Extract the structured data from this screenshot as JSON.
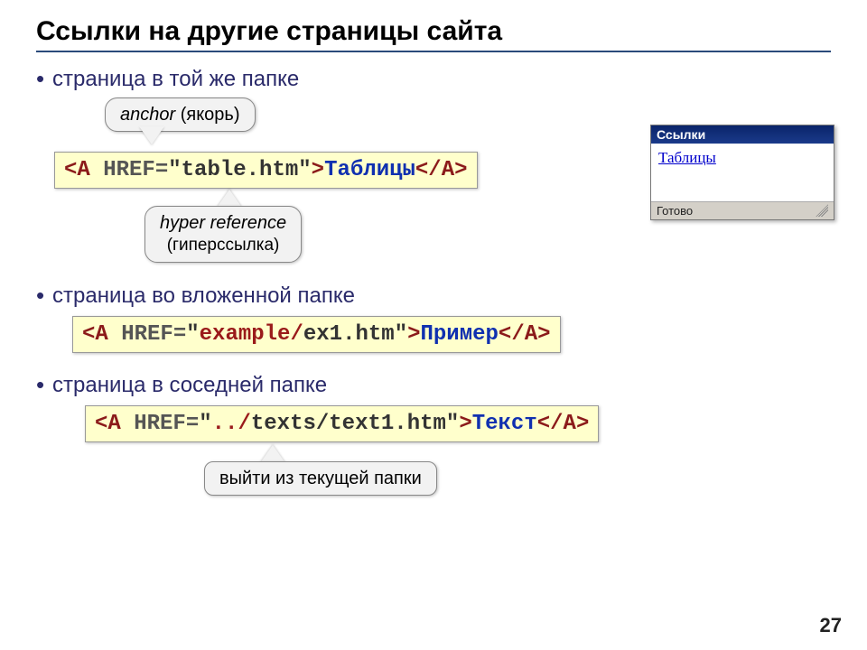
{
  "title": "Ссылки на другие страницы сайта",
  "bullets": {
    "b1": "страница в той же папке",
    "b2": "страница во вложенной папке",
    "b3": "страница в соседней папке"
  },
  "callouts": {
    "anchor_em": "anchor",
    "anchor_rest": " (якорь)",
    "href_em": "hyper reference",
    "href_sub": "(гиперссылка)",
    "up": "выйти из текущей папки"
  },
  "code1": {
    "lt": "<",
    "tagA": "A",
    "sp": " ",
    "attr": "HREF=",
    "val": "\"table.htm\"",
    "gt": ">",
    "link": "Таблицы",
    "close": "</",
    "tagA2": "A",
    "gt2": ">"
  },
  "code2": {
    "lt": "<",
    "tagA": "A",
    "sp": " ",
    "attr": "HREF=",
    "q": "\"",
    "folder": "example/",
    "file": "ex1.htm",
    "q2": "\"",
    "gt": ">",
    "link": "Пример",
    "close": "</",
    "tagA2": "A",
    "gt2": ">"
  },
  "code3": {
    "lt": "<",
    "tagA": "A",
    "sp": " ",
    "attr": "HREF=",
    "q": "\"",
    "up": "../",
    "rest": "texts/text1.htm",
    "q2": "\"",
    "gt": ">",
    "link": "Текст",
    "close": "</",
    "tagA2": "A",
    "gt2": ">"
  },
  "browser": {
    "title": "Ссылки",
    "link": "Таблицы",
    "status": "Готово"
  },
  "page": "27"
}
